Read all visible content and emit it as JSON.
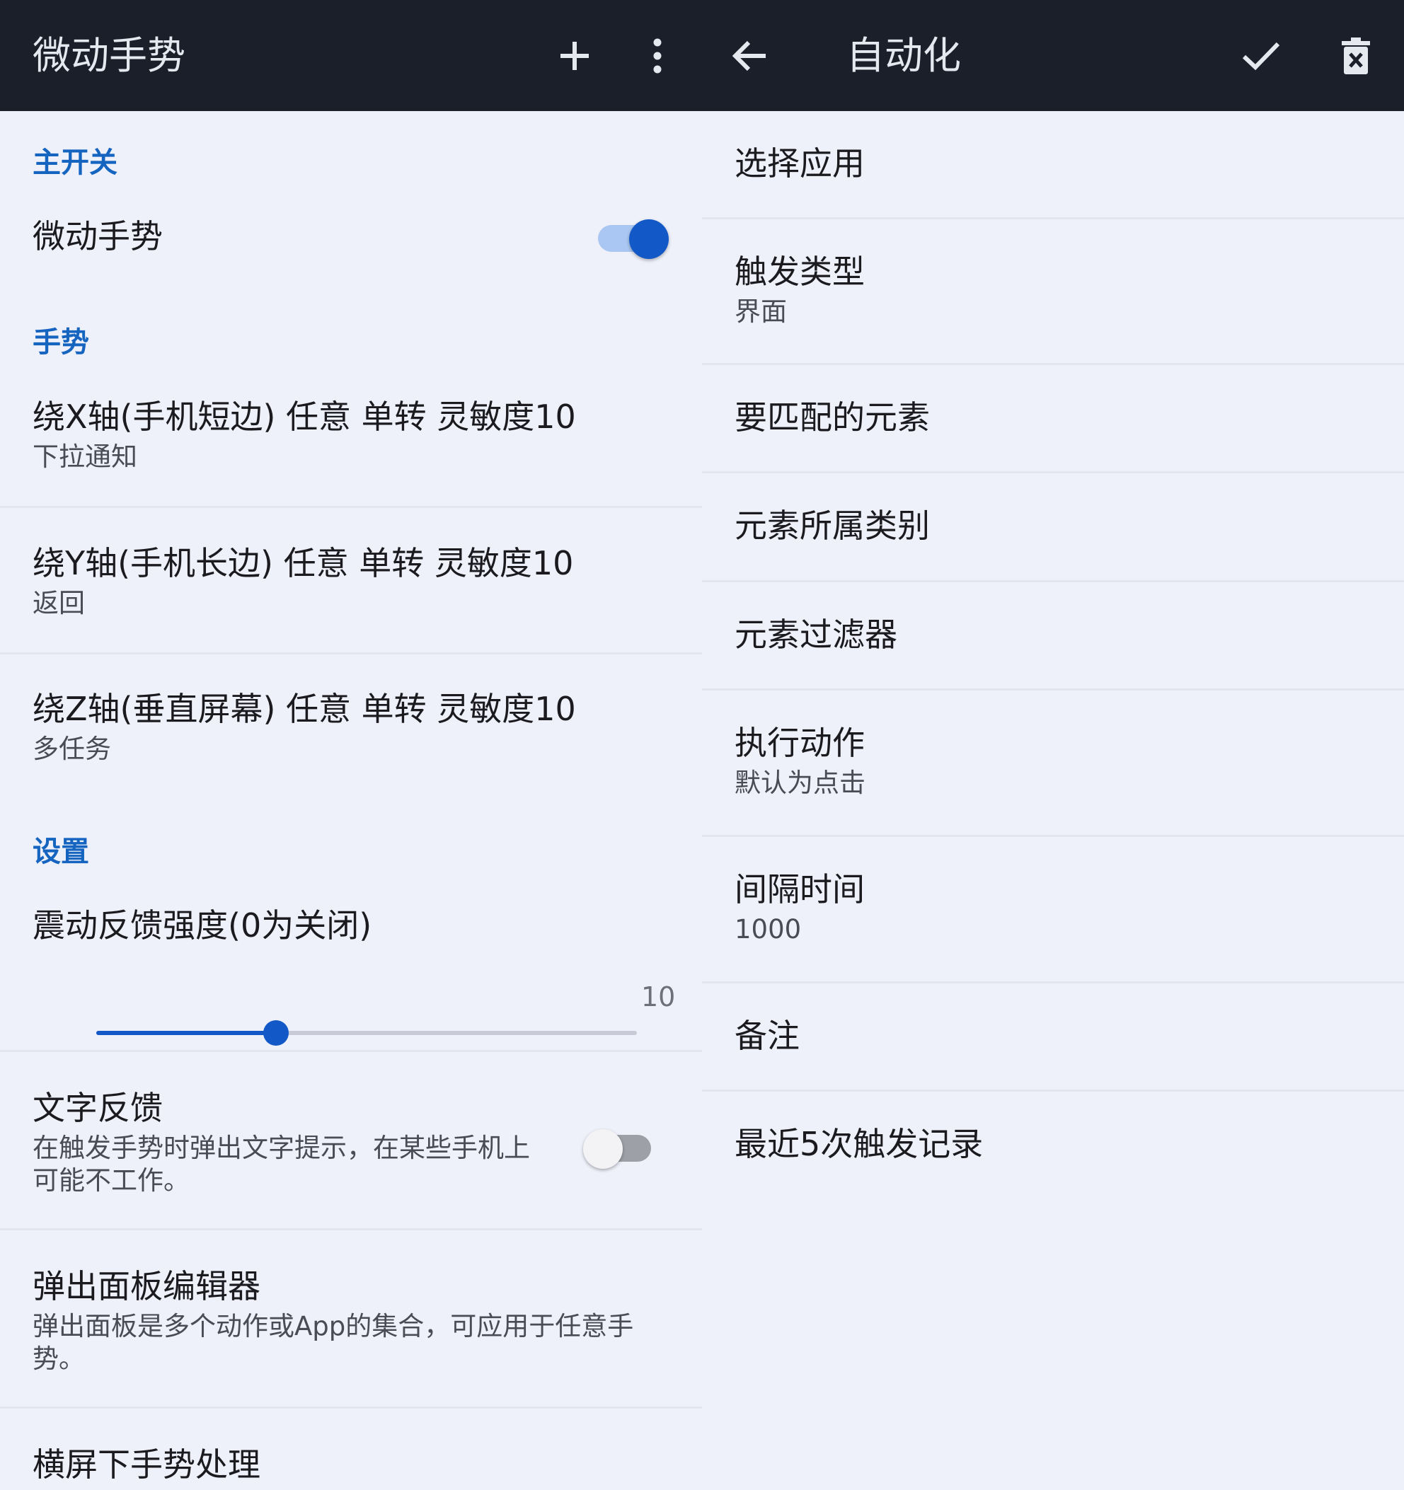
{
  "left_pane": {
    "appbar": {
      "title": "微动手势",
      "add_icon": "plus-icon",
      "more_icon": "more-vert-icon"
    },
    "sections": {
      "main_switch": "主开关",
      "gestures": "手势",
      "settings": "设置"
    },
    "master_toggle": {
      "label": "微动手势",
      "checked": true
    },
    "gesture_items": [
      {
        "title": "绕X轴(手机短边) 任意 单转 灵敏度10",
        "subtitle": "下拉通知"
      },
      {
        "title": "绕Y轴(手机长边) 任意 单转 灵敏度10",
        "subtitle": "返回"
      },
      {
        "title": "绕Z轴(垂直屏幕) 任意 单转 灵敏度10",
        "subtitle": "多任务"
      }
    ],
    "vibration": {
      "label": "震动反馈强度(0为关闭)",
      "value": "10",
      "fraction": 0.333
    },
    "text_feedback": {
      "title": "文字反馈",
      "subtitle": "在触发手势时弹出文字提示，在某些手机上可能不工作。",
      "checked": false
    },
    "panel_editor": {
      "title": "弹出面板编辑器",
      "subtitle": "弹出面板是多个动作或App的集合，可应用于任意手势。"
    },
    "landscape": {
      "title": "横屏下手势处理"
    }
  },
  "right_pane": {
    "appbar": {
      "title": "自动化",
      "back_icon": "arrow-back-icon",
      "confirm_icon": "check-icon",
      "delete_icon": "delete-icon"
    },
    "items": [
      {
        "title": "选择应用",
        "subtitle": ""
      },
      {
        "title": "触发类型",
        "subtitle": "界面"
      },
      {
        "title": "要匹配的元素",
        "subtitle": ""
      },
      {
        "title": "元素所属类别",
        "subtitle": ""
      },
      {
        "title": "元素过滤器",
        "subtitle": ""
      },
      {
        "title": "执行动作",
        "subtitle": "默认为点击"
      },
      {
        "title": "间隔时间",
        "subtitle": "1000"
      },
      {
        "title": "备注",
        "subtitle": ""
      },
      {
        "title": "最近5次触发记录",
        "subtitle": ""
      }
    ]
  },
  "colors": {
    "appbar_bg": "#1b1f2a",
    "page_bg": "#eef0fa",
    "accent": "#1258c7",
    "section_header": "#1565c0"
  }
}
